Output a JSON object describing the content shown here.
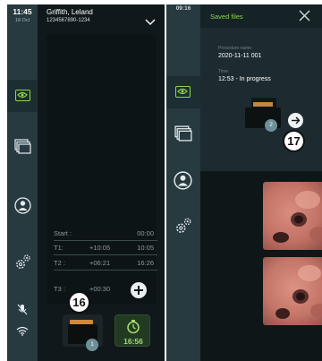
{
  "screen1": {
    "clock": "11:45",
    "date": "18 Oct",
    "patient": {
      "name": "Griffith, Leland",
      "id": "1234567890-1234"
    },
    "times": [
      {
        "label": "Start :",
        "offset": "",
        "time": "00:00"
      },
      {
        "label": "T1:",
        "offset": "+10:05",
        "time": "10:05"
      },
      {
        "label": "T2 :",
        "offset": "+06:21",
        "time": "16:26"
      },
      {
        "label": "T3 :",
        "offset": "+00:30",
        "time": ""
      }
    ],
    "saved_count": "1",
    "timer_value": "16:56",
    "callout": "16"
  },
  "screen2": {
    "clock": "09:16",
    "title": "Saved files",
    "procedure_name_label": "Procedure name:",
    "procedure_name": "2020-11-11 001",
    "time_label": "Time:",
    "time_value": "12:53 - In progress",
    "folder_count": "2",
    "callout": "17"
  },
  "colors": {
    "accent": "#8fd44c",
    "sidebar": "#263a40",
    "background": "#10181b"
  },
  "icons": [
    "eye-icon",
    "folders-icon",
    "patient-icon",
    "settings-icon",
    "mic-off-icon",
    "wifi-icon",
    "chevron-down-icon",
    "close-icon",
    "arrow-right-icon",
    "timer-icon",
    "plus-icon"
  ]
}
